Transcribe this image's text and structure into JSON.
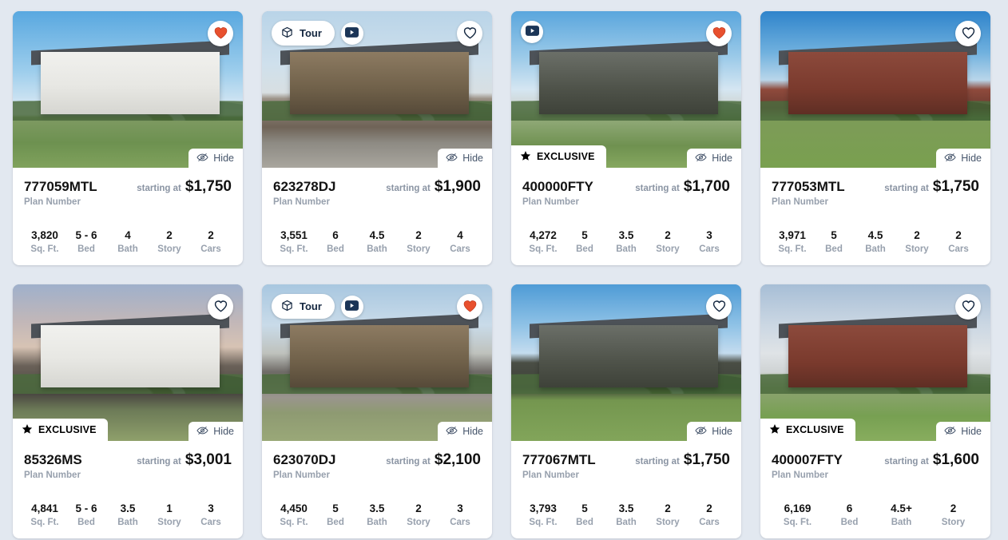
{
  "page": {
    "background_color": "#e2e8f0",
    "card_background": "#ffffff",
    "heart_filled_color": "#e8502e",
    "icon_navy": "#13263f",
    "muted_text_color": "#97a0ad"
  },
  "labels": {
    "tour": "Tour",
    "hide": "Hide",
    "exclusive": "EXCLUSIVE",
    "plan_caption": "Plan Number",
    "price_prefix": "starting at"
  },
  "icons": {
    "tour": "cube-3d-icon",
    "video": "video-play-icon",
    "heart_filled": "heart-filled-icon",
    "heart_outline": "heart-outline-icon",
    "hide": "eye-slash-icon",
    "exclusive": "star-icon"
  },
  "cards": [
    {
      "plan_number": "777059MTL",
      "price": "$1,750",
      "favorited": true,
      "exclusive": false,
      "has_tour": false,
      "has_video": false,
      "photo_variant": "v1",
      "stats": [
        {
          "value": "3,820",
          "label": "Sq. Ft."
        },
        {
          "value": "5 - 6",
          "label": "Bed"
        },
        {
          "value": "4",
          "label": "Bath"
        },
        {
          "value": "2",
          "label": "Story"
        },
        {
          "value": "2",
          "label": "Cars"
        }
      ]
    },
    {
      "plan_number": "623278DJ",
      "price": "$1,900",
      "favorited": false,
      "exclusive": false,
      "has_tour": true,
      "has_video": true,
      "photo_variant": "v2",
      "stats": [
        {
          "value": "3,551",
          "label": "Sq. Ft."
        },
        {
          "value": "6",
          "label": "Bed"
        },
        {
          "value": "4.5",
          "label": "Bath"
        },
        {
          "value": "2",
          "label": "Story"
        },
        {
          "value": "4",
          "label": "Cars"
        }
      ]
    },
    {
      "plan_number": "400000FTY",
      "price": "$1,700",
      "favorited": true,
      "exclusive": true,
      "has_tour": false,
      "has_video": true,
      "photo_variant": "v3",
      "stats": [
        {
          "value": "4,272",
          "label": "Sq. Ft."
        },
        {
          "value": "5",
          "label": "Bed"
        },
        {
          "value": "3.5",
          "label": "Bath"
        },
        {
          "value": "2",
          "label": "Story"
        },
        {
          "value": "3",
          "label": "Cars"
        }
      ]
    },
    {
      "plan_number": "777053MTL",
      "price": "$1,750",
      "favorited": false,
      "exclusive": false,
      "has_tour": false,
      "has_video": false,
      "photo_variant": "v4",
      "stats": [
        {
          "value": "3,971",
          "label": "Sq. Ft."
        },
        {
          "value": "5",
          "label": "Bed"
        },
        {
          "value": "4.5",
          "label": "Bath"
        },
        {
          "value": "2",
          "label": "Story"
        },
        {
          "value": "2",
          "label": "Cars"
        }
      ]
    },
    {
      "plan_number": "85326MS",
      "price": "$3,001",
      "favorited": false,
      "exclusive": true,
      "has_tour": false,
      "has_video": false,
      "photo_variant": "v5",
      "stats": [
        {
          "value": "4,841",
          "label": "Sq. Ft."
        },
        {
          "value": "5 - 6",
          "label": "Bed"
        },
        {
          "value": "3.5",
          "label": "Bath"
        },
        {
          "value": "1",
          "label": "Story"
        },
        {
          "value": "3",
          "label": "Cars"
        }
      ]
    },
    {
      "plan_number": "623070DJ",
      "price": "$2,100",
      "favorited": true,
      "exclusive": false,
      "has_tour": true,
      "has_video": true,
      "photo_variant": "v6",
      "stats": [
        {
          "value": "4,450",
          "label": "Sq. Ft."
        },
        {
          "value": "5",
          "label": "Bed"
        },
        {
          "value": "3.5",
          "label": "Bath"
        },
        {
          "value": "2",
          "label": "Story"
        },
        {
          "value": "3",
          "label": "Cars"
        }
      ]
    },
    {
      "plan_number": "777067MTL",
      "price": "$1,750",
      "favorited": false,
      "exclusive": false,
      "has_tour": false,
      "has_video": false,
      "photo_variant": "v7",
      "stats": [
        {
          "value": "3,793",
          "label": "Sq. Ft."
        },
        {
          "value": "5",
          "label": "Bed"
        },
        {
          "value": "3.5",
          "label": "Bath"
        },
        {
          "value": "2",
          "label": "Story"
        },
        {
          "value": "2",
          "label": "Cars"
        }
      ]
    },
    {
      "plan_number": "400007FTY",
      "price": "$1,600",
      "favorited": false,
      "exclusive": true,
      "has_tour": false,
      "has_video": false,
      "photo_variant": "v8",
      "stats": [
        {
          "value": "6,169",
          "label": "Sq. Ft."
        },
        {
          "value": "6",
          "label": "Bed"
        },
        {
          "value": "4.5+",
          "label": "Bath"
        },
        {
          "value": "2",
          "label": "Story"
        }
      ]
    }
  ]
}
